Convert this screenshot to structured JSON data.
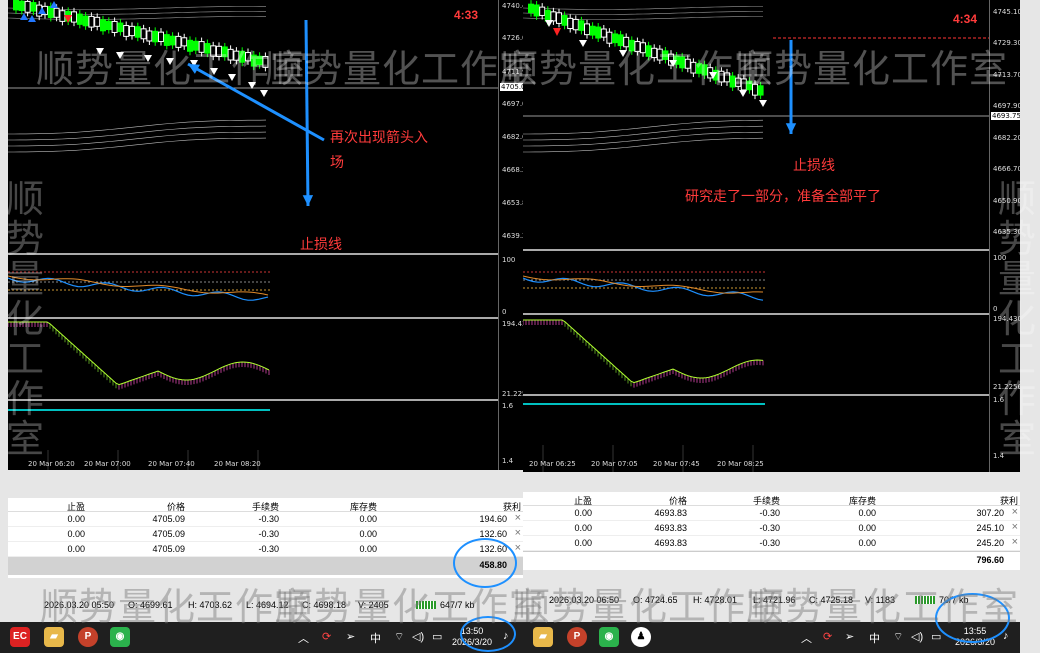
{
  "watermark": "顺势量化工作室",
  "left": {
    "price_ticks": [
      "4740.40",
      "4726.00",
      "4711.90",
      "4705.01",
      "4697.00",
      "4682.60",
      "4668.20",
      "4653.80",
      "4639.20"
    ],
    "current_price": "4705.01",
    "countdown": "4:33",
    "osc_ticks": [
      "100",
      "0"
    ],
    "ind_ticks": [
      "194.4307",
      "21.2256"
    ],
    "ind3_ticks": [
      "1.6",
      "1.4"
    ],
    "time_labels": [
      "20 Mar 06:20",
      "20 Mar 07:00",
      "20 Mar 07:40",
      "20 Mar 08:20"
    ],
    "annotation_entry": "再次出现箭头入场",
    "annotation_entry_l1": "再次出现箭头入",
    "annotation_entry_l2": "场",
    "annotation_stop": "止损线",
    "table": {
      "headers": [
        "止盈",
        "价格",
        "手续费",
        "库存费",
        "获利"
      ],
      "rows": [
        [
          "0.00",
          "4705.09",
          "-0.30",
          "0.00",
          "194.60"
        ],
        [
          "0.00",
          "4705.09",
          "-0.30",
          "0.00",
          "132.60"
        ],
        [
          "0.00",
          "4705.09",
          "-0.30",
          "0.00",
          "132.60"
        ]
      ],
      "total": "458.80"
    },
    "status": {
      "time": "2026.03.20 05:50",
      "o": "O: 4699.61",
      "h": "H: 4703.62",
      "l": "L: 4694.12",
      "c": "C: 4698.18",
      "v": "V: 2405",
      "kb": "647/7 kb"
    },
    "clock_time": "13:50",
    "clock_date": "2026/3/20",
    "ime": "中"
  },
  "right": {
    "price_ticks": [
      "4745.10",
      "4729.30",
      "4713.70",
      "4697.90",
      "4693.75",
      "4682.20",
      "4666.70",
      "4650.90",
      "4635.30"
    ],
    "current_price": "4693.75",
    "countdown": "4:34",
    "osc_ticks": [
      "100",
      "0"
    ],
    "ind_ticks": [
      "194.4307",
      "21.2256"
    ],
    "ind3_ticks": [
      "1.6",
      "1.4"
    ],
    "time_labels": [
      "20 Mar 06:25",
      "20 Mar 07:05",
      "20 Mar 07:45",
      "20 Mar 08:25"
    ],
    "annotation_stop": "止损线",
    "annotation_close": "研究走了一部分，准备全部平了",
    "table": {
      "headers": [
        "止盈",
        "价格",
        "手续费",
        "库存费",
        "获利"
      ],
      "rows": [
        [
          "0.00",
          "4693.83",
          "-0.30",
          "0.00",
          "307.20"
        ],
        [
          "0.00",
          "4693.83",
          "-0.30",
          "0.00",
          "245.10"
        ],
        [
          "0.00",
          "4693.83",
          "-0.30",
          "0.00",
          "245.20"
        ]
      ],
      "total": "796.60"
    },
    "status": {
      "time": "2026.03.20 06:50",
      "o": "O: 4724.65",
      "h": "H: 4728.01",
      "l": "L: 4721.96",
      "c": "C: 4725.18",
      "v": "V: 1183",
      "kb": "70/7 kb"
    },
    "clock_time": "13:55",
    "clock_date": "2026/3/20",
    "ime": "中"
  },
  "taskbar_icons": [
    "ec-app-icon",
    "folder-icon",
    "powerpoint-icon",
    "wechat-icon",
    "qq-icon"
  ],
  "colors": {
    "bull": "#00ff00",
    "bear": "#ffffff",
    "buy_arrow": "#2277ff",
    "sell_arrow": "#ff2222",
    "cyan": "#00ffff",
    "osc_blue": "#1e90ff",
    "annot": "#ff3b3b"
  }
}
